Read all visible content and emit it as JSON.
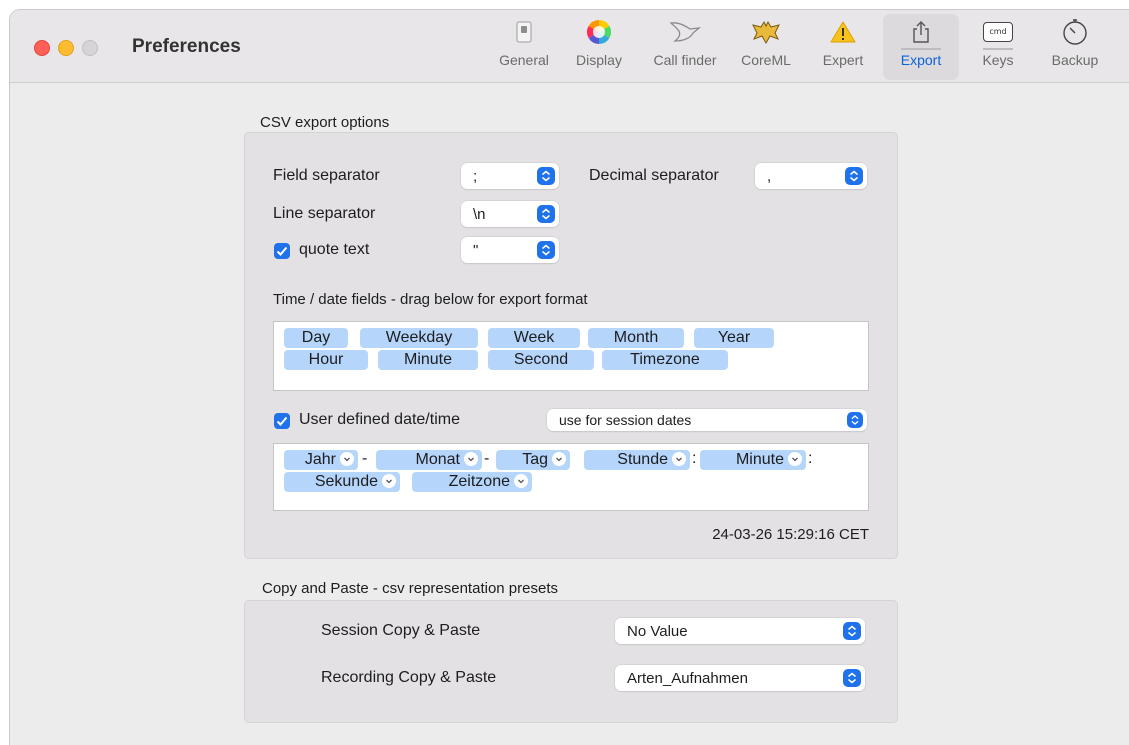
{
  "window": {
    "title": "Preferences"
  },
  "toolbar": {
    "items": [
      {
        "label": "General",
        "icon": "general-switch-icon"
      },
      {
        "label": "Display",
        "icon": "color-wheel-icon"
      },
      {
        "label": "Call finder",
        "icon": "bird-outline-icon"
      },
      {
        "label": "CoreML",
        "icon": "bat-icon"
      },
      {
        "label": "Expert",
        "icon": "warning-icon"
      },
      {
        "label": "Export",
        "icon": "share-icon",
        "selected": true
      },
      {
        "label": "Keys",
        "icon": "cmd-key-icon"
      },
      {
        "label": "Backup",
        "icon": "timer-icon"
      }
    ],
    "keys_icon_text": "cmd"
  },
  "csv": {
    "section_title": "CSV export options",
    "field_separator_label": "Field separator",
    "field_separator_value": ";",
    "decimal_separator_label": "Decimal separator",
    "decimal_separator_value": ",",
    "line_separator_label": "Line separator",
    "line_separator_value": "\\n",
    "quote_text_label": "quote text",
    "quote_text_checked": true,
    "quote_char_value": "\"",
    "time_fields_label": "Time / date fields - drag below for export format",
    "time_tokens": [
      "Day",
      "Weekday",
      "Week",
      "Month",
      "Year",
      "Hour",
      "Minute",
      "Second",
      "Timezone"
    ],
    "user_defined_label": "User defined date/time",
    "user_defined_checked": true,
    "use_for_value": "use for session dates",
    "format_tokens": [
      "Jahr",
      "Monat",
      "Tag",
      "Stunde",
      "Minute",
      "Sekunde",
      "Zeitzone"
    ],
    "format_separators": [
      "-",
      "-",
      ":",
      ":"
    ],
    "preview": "24-03-26 15:29:16 CET"
  },
  "copy_paste": {
    "section_title": "Copy and Paste - csv representation presets",
    "session_label": "Session Copy & Paste",
    "session_value": "No Value",
    "recording_label": "Recording Copy & Paste",
    "recording_value": "Arten_Aufnahmen"
  },
  "colors": {
    "accent": "#1f72ea",
    "token": "#b5d5fb",
    "selected_label": "#0a63d8"
  }
}
